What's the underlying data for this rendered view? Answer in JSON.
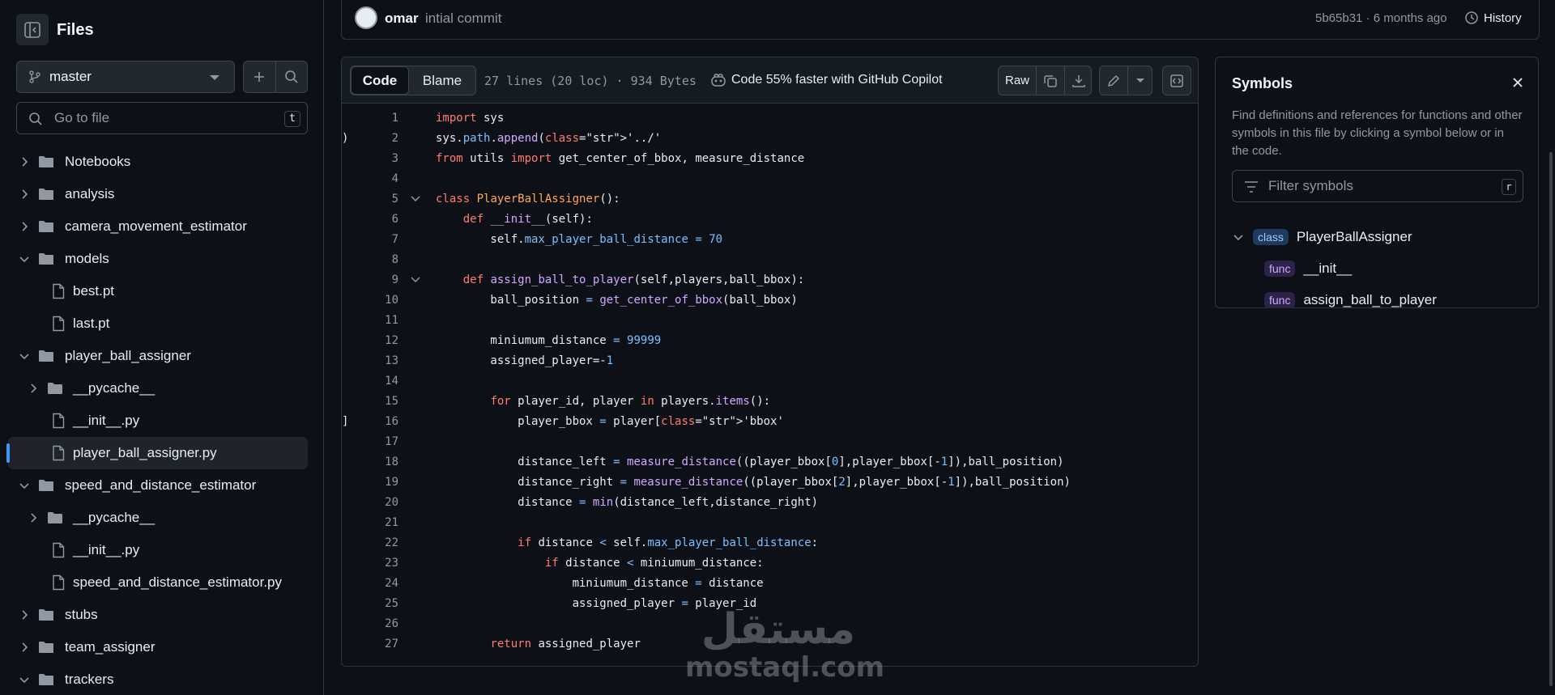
{
  "sidebar": {
    "title": "Files",
    "branch": "master",
    "goto_placeholder": "Go to file",
    "goto_shortcut": "t",
    "tree": [
      {
        "label": "Notebooks",
        "type": "folder",
        "expanded": false
      },
      {
        "label": "analysis",
        "type": "folder",
        "expanded": false
      },
      {
        "label": "camera_movement_estimator",
        "type": "folder",
        "expanded": false
      },
      {
        "label": "models",
        "type": "folder",
        "expanded": true
      },
      {
        "label": "best.pt",
        "type": "file"
      },
      {
        "label": "last.pt",
        "type": "file"
      },
      {
        "label": "player_ball_assigner",
        "type": "folder",
        "expanded": true
      },
      {
        "label": "__pycache__",
        "type": "folder",
        "expanded": false
      },
      {
        "label": "__init__.py",
        "type": "file"
      },
      {
        "label": "player_ball_assigner.py",
        "type": "file",
        "active": true
      },
      {
        "label": "speed_and_distance_estimator",
        "type": "folder",
        "expanded": true
      },
      {
        "label": "__pycache__",
        "type": "folder",
        "expanded": false
      },
      {
        "label": "__init__.py",
        "type": "file"
      },
      {
        "label": "speed_and_distance_estimator.py",
        "type": "file"
      },
      {
        "label": "stubs",
        "type": "folder",
        "expanded": false
      },
      {
        "label": "team_assigner",
        "type": "folder",
        "expanded": false
      },
      {
        "label": "trackers",
        "type": "folder",
        "expanded": true
      }
    ]
  },
  "commit": {
    "author": "omar",
    "message": "intial commit",
    "meta": "5b65b31 · 6 months ago",
    "history_label": "History"
  },
  "code_header": {
    "tab_code": "Code",
    "tab_blame": "Blame",
    "file_meta": "27 lines (20 loc) · 934 Bytes",
    "copilot": "Code 55% faster with GitHub Copilot",
    "raw": "Raw"
  },
  "code_lines": [
    "import sys",
    "sys.path.append('../')",
    "from utils import get_center_of_bbox, measure_distance",
    "",
    "class PlayerBallAssigner():",
    "    def __init__(self):",
    "        self.max_player_ball_distance = 70",
    "",
    "    def assign_ball_to_player(self,players,ball_bbox):",
    "        ball_position = get_center_of_bbox(ball_bbox)",
    "",
    "        miniumum_distance = 99999",
    "        assigned_player=-1",
    "",
    "        for player_id, player in players.items():",
    "            player_bbox = player['bbox']",
    "",
    "            distance_left = measure_distance((player_bbox[0],player_bbox[-1]),ball_position)",
    "            distance_right = measure_distance((player_bbox[2],player_bbox[-1]),ball_position)",
    "            distance = min(distance_left,distance_right)",
    "",
    "            if distance < self.max_player_ball_distance:",
    "                if distance < miniumum_distance:",
    "                    miniumum_distance = distance",
    "                    assigned_player = player_id",
    "",
    "        return assigned_player"
  ],
  "symbols": {
    "title": "Symbols",
    "description": "Find definitions and references for functions and other symbols in this file by clicking a symbol below or in the code.",
    "filter_placeholder": "Filter symbols",
    "filter_shortcut": "r",
    "items": [
      {
        "kind": "class",
        "name": "PlayerBallAssigner"
      },
      {
        "kind": "func",
        "name": "__init__"
      },
      {
        "kind": "func",
        "name": "assign_ball_to_player"
      }
    ]
  },
  "watermark": {
    "arabic": "مستقل",
    "latin": "mostaql.com"
  },
  "colors": {
    "background": "#0d1117",
    "border": "#30363d",
    "accent": "#4493f8",
    "keyword": "#ff7b72",
    "function": "#d2a8ff",
    "class": "#ffa657",
    "number": "#79c0ff"
  }
}
